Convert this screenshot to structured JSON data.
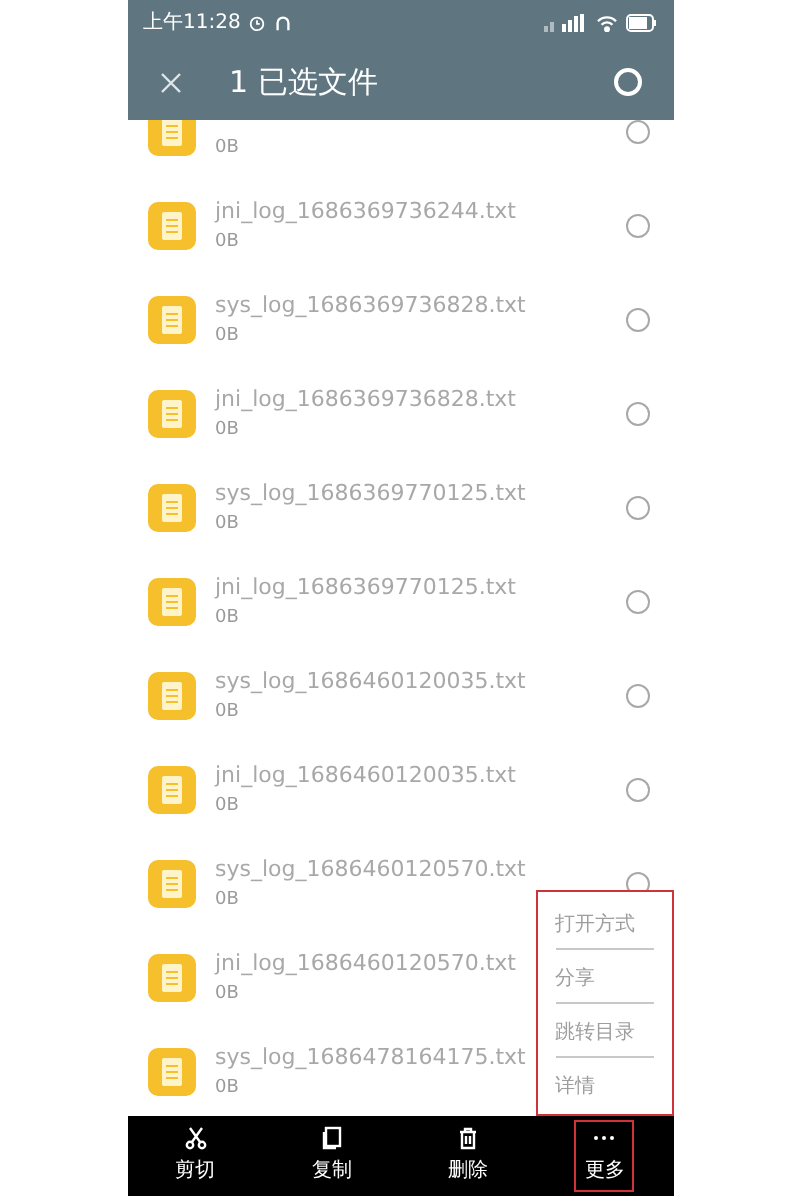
{
  "status_bar": {
    "time": "上午11:28"
  },
  "header": {
    "title": "1 已选文件",
    "select_all_selected": false
  },
  "files": [
    {
      "size": "0B",
      "selected": false
    },
    {
      "name": "jni_log_1686369736244.txt",
      "size": "0B",
      "selected": false
    },
    {
      "name": "sys_log_1686369736828.txt",
      "size": "0B",
      "selected": false
    },
    {
      "name": "jni_log_1686369736828.txt",
      "size": "0B",
      "selected": false
    },
    {
      "name": "sys_log_1686369770125.txt",
      "size": "0B",
      "selected": false
    },
    {
      "name": "jni_log_1686369770125.txt",
      "size": "0B",
      "selected": false
    },
    {
      "name": "sys_log_1686460120035.txt",
      "size": "0B",
      "selected": false
    },
    {
      "name": "jni_log_1686460120035.txt",
      "size": "0B",
      "selected": false
    },
    {
      "name": "sys_log_1686460120570.txt",
      "size": "0B",
      "selected": false
    },
    {
      "name": "jni_log_1686460120570.txt",
      "size": "0B"
    },
    {
      "name": "sys_log_1686478164175.txt",
      "size": "0B"
    }
  ],
  "more_menu": {
    "highlighted": true,
    "items": [
      {
        "label": "打开方式",
        "disabled": true
      },
      {
        "label": "分享",
        "disabled": true
      },
      {
        "label": "跳转目录",
        "disabled": true
      },
      {
        "label": "详情",
        "disabled": true
      }
    ]
  },
  "toolbar": [
    {
      "kind": "cut",
      "label": "剪切",
      "highlighted": false
    },
    {
      "kind": "copy",
      "label": "复制",
      "highlighted": false
    },
    {
      "kind": "delete",
      "label": "删除",
      "highlighted": false
    },
    {
      "kind": "more",
      "label": "更多",
      "highlighted": true
    }
  ]
}
